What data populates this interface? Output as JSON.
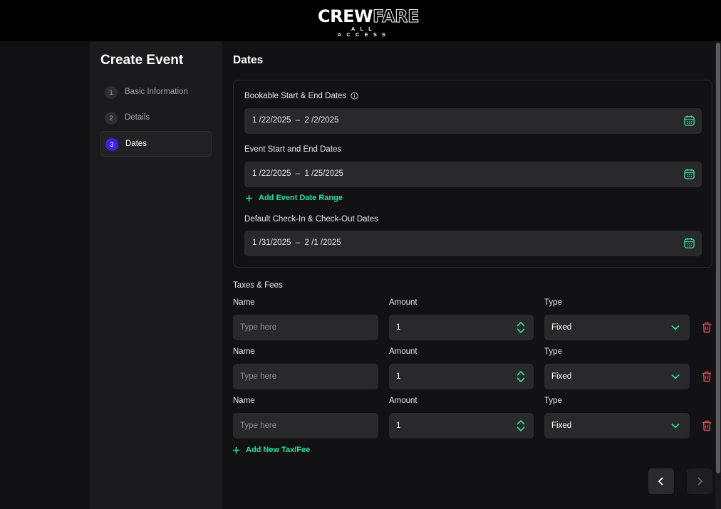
{
  "app": {
    "logo_main_left": "CREW",
    "logo_main_right": "FARE",
    "logo_sub": "ALL ACCESS"
  },
  "sidebar": {
    "title": "Create Event",
    "steps": [
      {
        "num": "1",
        "label": "Basic Information",
        "active": false
      },
      {
        "num": "2",
        "label": "Details",
        "active": false
      },
      {
        "num": "3",
        "label": "Dates",
        "active": true
      }
    ]
  },
  "main": {
    "title": "Dates",
    "bookable_label": "Bookable Start & End Dates",
    "bookable_value": "1 /22/2025  –  2 /2/2025",
    "event_label": "Event Start and End Dates",
    "event_value": "1 /22/2025  –  1 /25/2025",
    "add_event_range": "Add Event Date Range",
    "checkin_label": "Default Check-In & Check-Out Dates",
    "checkin_value": "1 /31/2025  –  2 /1 /2025",
    "taxes_title": "Taxes & Fees",
    "add_tax": "Add New Tax/Fee",
    "tax_rows": [
      {
        "name_label": "Name",
        "name_placeholder": "Type here",
        "amount_label": "Amount",
        "amount_value": "1",
        "type_label": "Type",
        "type_value": "Fixed"
      },
      {
        "name_label": "Name",
        "name_placeholder": "Type here",
        "amount_label": "Amount",
        "amount_value": "1",
        "type_label": "Type",
        "type_value": "Fixed"
      },
      {
        "name_label": "Name",
        "name_placeholder": "Type here",
        "amount_label": "Amount",
        "amount_value": "1",
        "type_label": "Type",
        "type_value": "Fixed"
      }
    ]
  },
  "icons": {
    "info": "info-icon",
    "calendar": "calendar-icon",
    "plus": "plus-icon",
    "stepper": "stepper-arrows-icon",
    "dropdown": "chevron-down-icon",
    "delete": "trash-icon",
    "prev": "chevron-left-icon",
    "next": "chevron-right-icon"
  },
  "colors": {
    "accent": "#2fe0a0",
    "active_step": "#3d22e4",
    "delete": "#e5484d",
    "background": "#121214",
    "input": "#29292c"
  }
}
